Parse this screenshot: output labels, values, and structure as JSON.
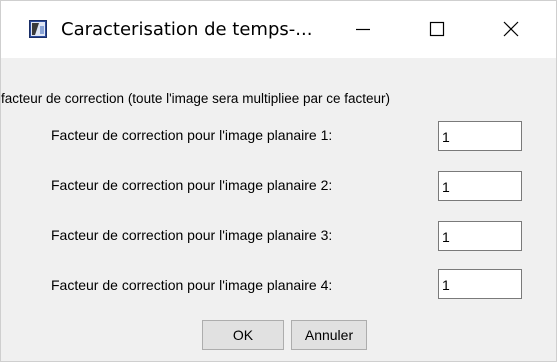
{
  "window": {
    "title": "Caracterisation de temps-...",
    "icon": "app-window-icon"
  },
  "titlebar_controls": [
    "minimize-icon",
    "maximize-icon",
    "close-icon"
  ],
  "description": "facteur de correction  (toute l'image sera multipliee par ce facteur)",
  "fields": [
    {
      "label": "Facteur de correction pour l'image planaire 1:",
      "value": "1"
    },
    {
      "label": "Facteur de correction pour l'image planaire 2:",
      "value": "1"
    },
    {
      "label": "Facteur de correction pour l'image planaire 3:",
      "value": "1"
    },
    {
      "label": "Facteur de correction pour l'image planaire 4:",
      "value": "1"
    }
  ],
  "buttons": {
    "ok_label": "OK",
    "cancel_label": "Annuler"
  }
}
